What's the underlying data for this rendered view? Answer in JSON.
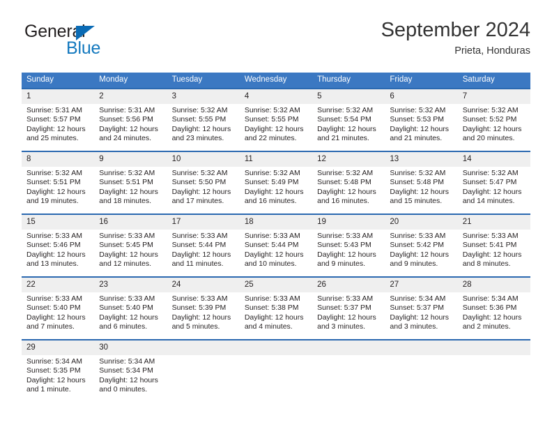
{
  "brand": {
    "name_top": "General",
    "name_bottom": "Blue",
    "accent_dark": "#0a6bb5",
    "accent_blue": "#1278be"
  },
  "header": {
    "title": "September 2024",
    "location": "Prieta, Honduras",
    "header_bg": "#3b78c2",
    "row_border": "#2a68b0",
    "daynum_bg": "#efefef"
  },
  "weekdays": [
    "Sunday",
    "Monday",
    "Tuesday",
    "Wednesday",
    "Thursday",
    "Friday",
    "Saturday"
  ],
  "weeks": [
    [
      {
        "day": "1",
        "sunrise": "Sunrise: 5:31 AM",
        "sunset": "Sunset: 5:57 PM",
        "daylight": "Daylight: 12 hours and 25 minutes."
      },
      {
        "day": "2",
        "sunrise": "Sunrise: 5:31 AM",
        "sunset": "Sunset: 5:56 PM",
        "daylight": "Daylight: 12 hours and 24 minutes."
      },
      {
        "day": "3",
        "sunrise": "Sunrise: 5:32 AM",
        "sunset": "Sunset: 5:55 PM",
        "daylight": "Daylight: 12 hours and 23 minutes."
      },
      {
        "day": "4",
        "sunrise": "Sunrise: 5:32 AM",
        "sunset": "Sunset: 5:55 PM",
        "daylight": "Daylight: 12 hours and 22 minutes."
      },
      {
        "day": "5",
        "sunrise": "Sunrise: 5:32 AM",
        "sunset": "Sunset: 5:54 PM",
        "daylight": "Daylight: 12 hours and 21 minutes."
      },
      {
        "day": "6",
        "sunrise": "Sunrise: 5:32 AM",
        "sunset": "Sunset: 5:53 PM",
        "daylight": "Daylight: 12 hours and 21 minutes."
      },
      {
        "day": "7",
        "sunrise": "Sunrise: 5:32 AM",
        "sunset": "Sunset: 5:52 PM",
        "daylight": "Daylight: 12 hours and 20 minutes."
      }
    ],
    [
      {
        "day": "8",
        "sunrise": "Sunrise: 5:32 AM",
        "sunset": "Sunset: 5:51 PM",
        "daylight": "Daylight: 12 hours and 19 minutes."
      },
      {
        "day": "9",
        "sunrise": "Sunrise: 5:32 AM",
        "sunset": "Sunset: 5:51 PM",
        "daylight": "Daylight: 12 hours and 18 minutes."
      },
      {
        "day": "10",
        "sunrise": "Sunrise: 5:32 AM",
        "sunset": "Sunset: 5:50 PM",
        "daylight": "Daylight: 12 hours and 17 minutes."
      },
      {
        "day": "11",
        "sunrise": "Sunrise: 5:32 AM",
        "sunset": "Sunset: 5:49 PM",
        "daylight": "Daylight: 12 hours and 16 minutes."
      },
      {
        "day": "12",
        "sunrise": "Sunrise: 5:32 AM",
        "sunset": "Sunset: 5:48 PM",
        "daylight": "Daylight: 12 hours and 16 minutes."
      },
      {
        "day": "13",
        "sunrise": "Sunrise: 5:32 AM",
        "sunset": "Sunset: 5:48 PM",
        "daylight": "Daylight: 12 hours and 15 minutes."
      },
      {
        "day": "14",
        "sunrise": "Sunrise: 5:32 AM",
        "sunset": "Sunset: 5:47 PM",
        "daylight": "Daylight: 12 hours and 14 minutes."
      }
    ],
    [
      {
        "day": "15",
        "sunrise": "Sunrise: 5:33 AM",
        "sunset": "Sunset: 5:46 PM",
        "daylight": "Daylight: 12 hours and 13 minutes."
      },
      {
        "day": "16",
        "sunrise": "Sunrise: 5:33 AM",
        "sunset": "Sunset: 5:45 PM",
        "daylight": "Daylight: 12 hours and 12 minutes."
      },
      {
        "day": "17",
        "sunrise": "Sunrise: 5:33 AM",
        "sunset": "Sunset: 5:44 PM",
        "daylight": "Daylight: 12 hours and 11 minutes."
      },
      {
        "day": "18",
        "sunrise": "Sunrise: 5:33 AM",
        "sunset": "Sunset: 5:44 PM",
        "daylight": "Daylight: 12 hours and 10 minutes."
      },
      {
        "day": "19",
        "sunrise": "Sunrise: 5:33 AM",
        "sunset": "Sunset: 5:43 PM",
        "daylight": "Daylight: 12 hours and 9 minutes."
      },
      {
        "day": "20",
        "sunrise": "Sunrise: 5:33 AM",
        "sunset": "Sunset: 5:42 PM",
        "daylight": "Daylight: 12 hours and 9 minutes."
      },
      {
        "day": "21",
        "sunrise": "Sunrise: 5:33 AM",
        "sunset": "Sunset: 5:41 PM",
        "daylight": "Daylight: 12 hours and 8 minutes."
      }
    ],
    [
      {
        "day": "22",
        "sunrise": "Sunrise: 5:33 AM",
        "sunset": "Sunset: 5:40 PM",
        "daylight": "Daylight: 12 hours and 7 minutes."
      },
      {
        "day": "23",
        "sunrise": "Sunrise: 5:33 AM",
        "sunset": "Sunset: 5:40 PM",
        "daylight": "Daylight: 12 hours and 6 minutes."
      },
      {
        "day": "24",
        "sunrise": "Sunrise: 5:33 AM",
        "sunset": "Sunset: 5:39 PM",
        "daylight": "Daylight: 12 hours and 5 minutes."
      },
      {
        "day": "25",
        "sunrise": "Sunrise: 5:33 AM",
        "sunset": "Sunset: 5:38 PM",
        "daylight": "Daylight: 12 hours and 4 minutes."
      },
      {
        "day": "26",
        "sunrise": "Sunrise: 5:33 AM",
        "sunset": "Sunset: 5:37 PM",
        "daylight": "Daylight: 12 hours and 3 minutes."
      },
      {
        "day": "27",
        "sunrise": "Sunrise: 5:34 AM",
        "sunset": "Sunset: 5:37 PM",
        "daylight": "Daylight: 12 hours and 3 minutes."
      },
      {
        "day": "28",
        "sunrise": "Sunrise: 5:34 AM",
        "sunset": "Sunset: 5:36 PM",
        "daylight": "Daylight: 12 hours and 2 minutes."
      }
    ],
    [
      {
        "day": "29",
        "sunrise": "Sunrise: 5:34 AM",
        "sunset": "Sunset: 5:35 PM",
        "daylight": "Daylight: 12 hours and 1 minute."
      },
      {
        "day": "30",
        "sunrise": "Sunrise: 5:34 AM",
        "sunset": "Sunset: 5:34 PM",
        "daylight": "Daylight: 12 hours and 0 minutes."
      },
      {
        "day": "",
        "sunrise": "",
        "sunset": "",
        "daylight": ""
      },
      {
        "day": "",
        "sunrise": "",
        "sunset": "",
        "daylight": ""
      },
      {
        "day": "",
        "sunrise": "",
        "sunset": "",
        "daylight": ""
      },
      {
        "day": "",
        "sunrise": "",
        "sunset": "",
        "daylight": ""
      },
      {
        "day": "",
        "sunrise": "",
        "sunset": "",
        "daylight": ""
      }
    ]
  ]
}
